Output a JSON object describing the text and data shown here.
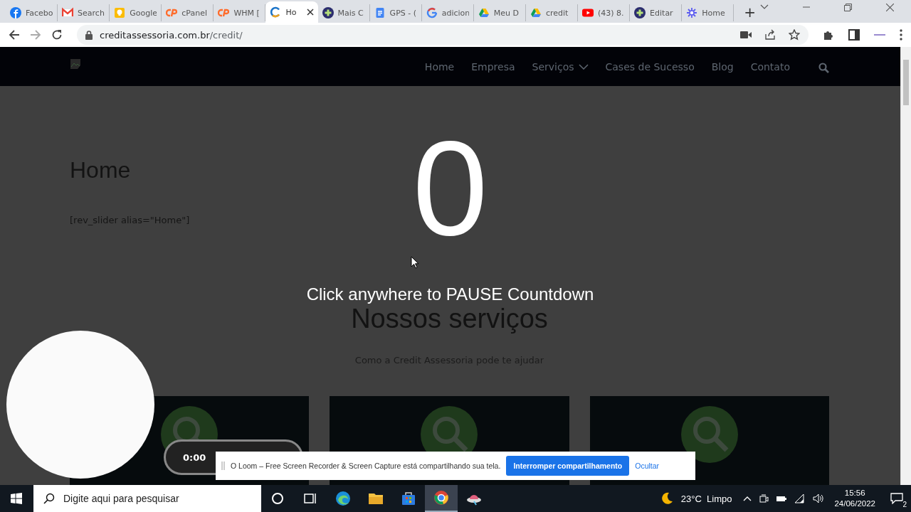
{
  "browser": {
    "tabs": [
      {
        "label": "Facebo",
        "kind": "fcircle",
        "selected": false
      },
      {
        "label": "Search",
        "kind": "envelope",
        "selected": false
      },
      {
        "label": "Google",
        "kind": "bulb",
        "selected": false
      },
      {
        "label": "cPanel",
        "kind": "cp",
        "selected": false
      },
      {
        "label": "WHM [",
        "kind": "cp",
        "selected": false
      },
      {
        "label": "Ho",
        "kind": "ring",
        "selected": true
      },
      {
        "label": "Mais C",
        "kind": "plus",
        "selected": false
      },
      {
        "label": "GPS - (",
        "kind": "doc",
        "selected": false
      },
      {
        "label": "adicion",
        "kind": "g",
        "selected": false
      },
      {
        "label": "Meu D",
        "kind": "triangle",
        "selected": false
      },
      {
        "label": "credit",
        "kind": "triangle",
        "selected": false
      },
      {
        "label": "(43) 8.",
        "kind": "play",
        "selected": false
      },
      {
        "label": "Editar",
        "kind": "plus",
        "selected": false
      },
      {
        "label": "Home",
        "kind": "asterisk",
        "selected": false
      }
    ],
    "new_tab": "+",
    "url_host": "creditassessoria.com.br",
    "url_path": "/credit/"
  },
  "site": {
    "nav": [
      {
        "label": "Home",
        "dropdown": false
      },
      {
        "label": "Empresa",
        "dropdown": false
      },
      {
        "label": "Serviços",
        "dropdown": true
      },
      {
        "label": "Cases de Sucesso",
        "dropdown": false
      },
      {
        "label": "Blog",
        "dropdown": false
      },
      {
        "label": "Contato",
        "dropdown": false
      }
    ],
    "title": "Home",
    "shortcode": "[rev_slider alias=\"Home\"]",
    "services_title": "Nossos serviços",
    "services_subtitle": "Como a Credit Assessoria pode te ajudar"
  },
  "countdown": {
    "number": "0",
    "hint": "Click anywhere to PAUSE Countdown"
  },
  "recorder": {
    "timer": "0:00"
  },
  "share_bar": {
    "message": "O Loom – Free Screen Recorder & Screen Capture está compartilhando sua tela.",
    "stop_button": "Interromper compartilhamento",
    "hide_link": "Ocultar"
  },
  "taskbar": {
    "search_placeholder": "Digite aqui para pesquisar",
    "weather": "23°C  Limpo",
    "time": "15:56",
    "date": "24/06/2022",
    "notifications": "2"
  }
}
